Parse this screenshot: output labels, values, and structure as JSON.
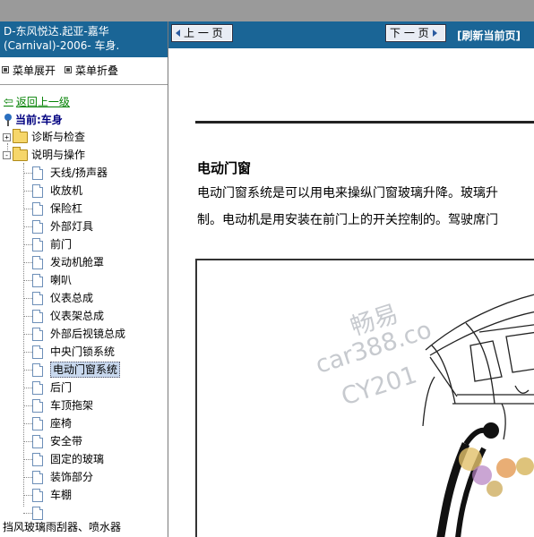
{
  "left_panel": {
    "title": "D-东风悦达.起亚-嘉华(Carnival)-2006- 车身.",
    "menu_expand": "菜单展开",
    "menu_collapse": "菜单折叠",
    "back_link": "返回上一级",
    "current_label": "当前:车身",
    "folders": [
      {
        "label": "诊断与检查",
        "toggle": "+"
      },
      {
        "label": "说明与操作",
        "toggle": "-"
      }
    ],
    "items": [
      "天线/扬声器",
      "收放机",
      "保险杠",
      "外部灯具",
      "前门",
      "发动机舱罩",
      "喇叭",
      "仪表总成",
      "仪表架总成",
      "外部后视镜总成",
      "中央门锁系统",
      "电动门窗系统",
      "后门",
      "车顶拖架",
      "座椅",
      "安全带",
      "固定的玻璃",
      "装饰部分",
      "车棚",
      ""
    ],
    "selected_item": "电动门窗系统",
    "bottom_item": "挡风玻璃雨刮器、喷水器"
  },
  "toolbar": {
    "prev_label": "上 一 页",
    "next_label": "下 一 页",
    "refresh_label": "[刷新当前页]"
  },
  "content": {
    "heading": "电动门窗",
    "paragraph_line1": "电动门窗系统是可以用电来操纵门窗玻璃升降。玻璃升",
    "paragraph_line2": "制。电动机是用安装在前门上的开关控制的。驾驶席门",
    "watermark_line1": "畅易",
    "watermark_line2": "car388.co",
    "watermark_line3": "CY201"
  },
  "colors": {
    "header_blue": "#1a6596",
    "link_green": "#008000",
    "current_navy": "#000080"
  }
}
